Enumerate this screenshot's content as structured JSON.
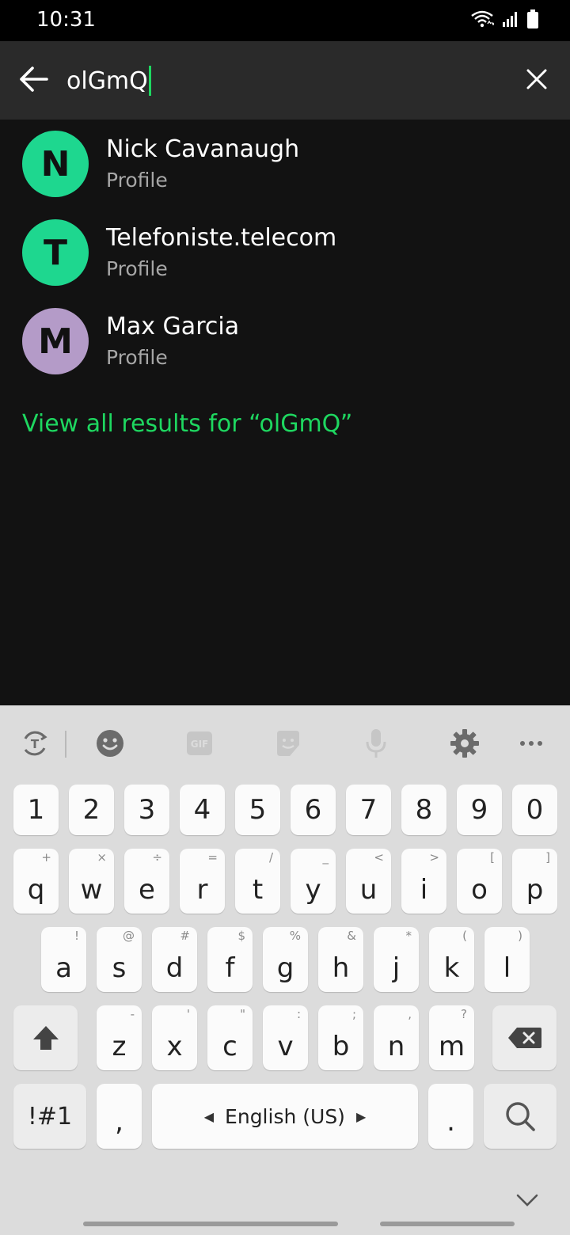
{
  "status_bar": {
    "time": "10:31",
    "icons": [
      "wifi-icon",
      "signal-icon",
      "battery-icon"
    ]
  },
  "search": {
    "query": "olGmQ",
    "back_icon": "back-arrow-icon",
    "clear_icon": "close-icon"
  },
  "results": [
    {
      "initial": "N",
      "name": "Nick Cavanaugh",
      "subtitle": "Profile",
      "avatar_color": "#1ed78f"
    },
    {
      "initial": "T",
      "name": "Telefoniste.telecom",
      "subtitle": "Profile",
      "avatar_color": "#1ed78f"
    },
    {
      "initial": "M",
      "name": "Max Garcia",
      "subtitle": "Profile",
      "avatar_color": "#b49bc8"
    }
  ],
  "view_all": "View all results for “olGmQ”",
  "keyboard": {
    "toolbar": [
      "translate-icon",
      "emoji-icon",
      "gif-icon",
      "sticker-icon",
      "mic-icon",
      "settings-icon",
      "more-icon"
    ],
    "gif_label": "GIF",
    "numbers": [
      "1",
      "2",
      "3",
      "4",
      "5",
      "6",
      "7",
      "8",
      "9",
      "0"
    ],
    "row1": [
      {
        "k": "q",
        "h": "+"
      },
      {
        "k": "w",
        "h": "×"
      },
      {
        "k": "e",
        "h": "÷"
      },
      {
        "k": "r",
        "h": "="
      },
      {
        "k": "t",
        "h": "/"
      },
      {
        "k": "y",
        "h": "_"
      },
      {
        "k": "u",
        "h": "<"
      },
      {
        "k": "i",
        "h": ">"
      },
      {
        "k": "o",
        "h": "["
      },
      {
        "k": "p",
        "h": "]"
      }
    ],
    "row2": [
      {
        "k": "a",
        "h": "!"
      },
      {
        "k": "s",
        "h": "@"
      },
      {
        "k": "d",
        "h": "#"
      },
      {
        "k": "f",
        "h": "$"
      },
      {
        "k": "g",
        "h": "%"
      },
      {
        "k": "h",
        "h": "&"
      },
      {
        "k": "j",
        "h": "*"
      },
      {
        "k": "k",
        "h": "("
      },
      {
        "k": "l",
        "h": ")"
      }
    ],
    "row3": [
      {
        "k": "z",
        "h": "-"
      },
      {
        "k": "x",
        "h": "'"
      },
      {
        "k": "c",
        "h": "\""
      },
      {
        "k": "v",
        "h": ":"
      },
      {
        "k": "b",
        "h": ";"
      },
      {
        "k": "n",
        "h": ","
      },
      {
        "k": "m",
        "h": "?"
      }
    ],
    "symbols_label": "!#1",
    "comma_label": ",",
    "space_label": "English (US)",
    "period_label": ".",
    "shift_icon": "shift-icon",
    "backspace_icon": "backspace-icon",
    "search_icon": "search-icon",
    "collapse_icon": "chevron-down-icon"
  },
  "colors": {
    "accent": "#1ed760",
    "background": "#121212",
    "search_bar": "#2a2a2a",
    "keyboard": "#dcdcdc"
  }
}
